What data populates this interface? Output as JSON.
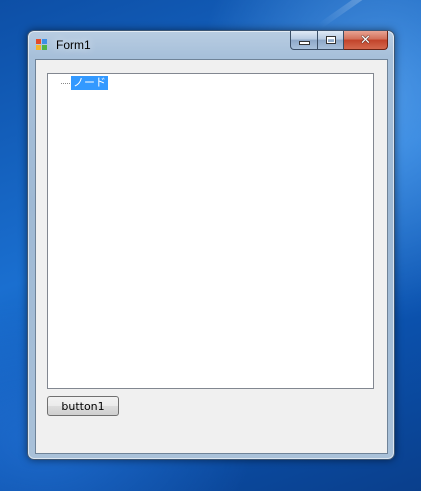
{
  "window": {
    "title": "Form1"
  },
  "caption": {
    "minimize_icon": "minimize-icon",
    "maximize_icon": "maximize-icon",
    "close_glyph": "✕"
  },
  "tree": {
    "nodes": [
      {
        "label": "ノード",
        "selected": true
      }
    ]
  },
  "buttons": {
    "button1_label": "button1"
  },
  "colors": {
    "selection": "#3399ff",
    "client_bg": "#f0f0f0",
    "close_button": "#c2432a"
  }
}
